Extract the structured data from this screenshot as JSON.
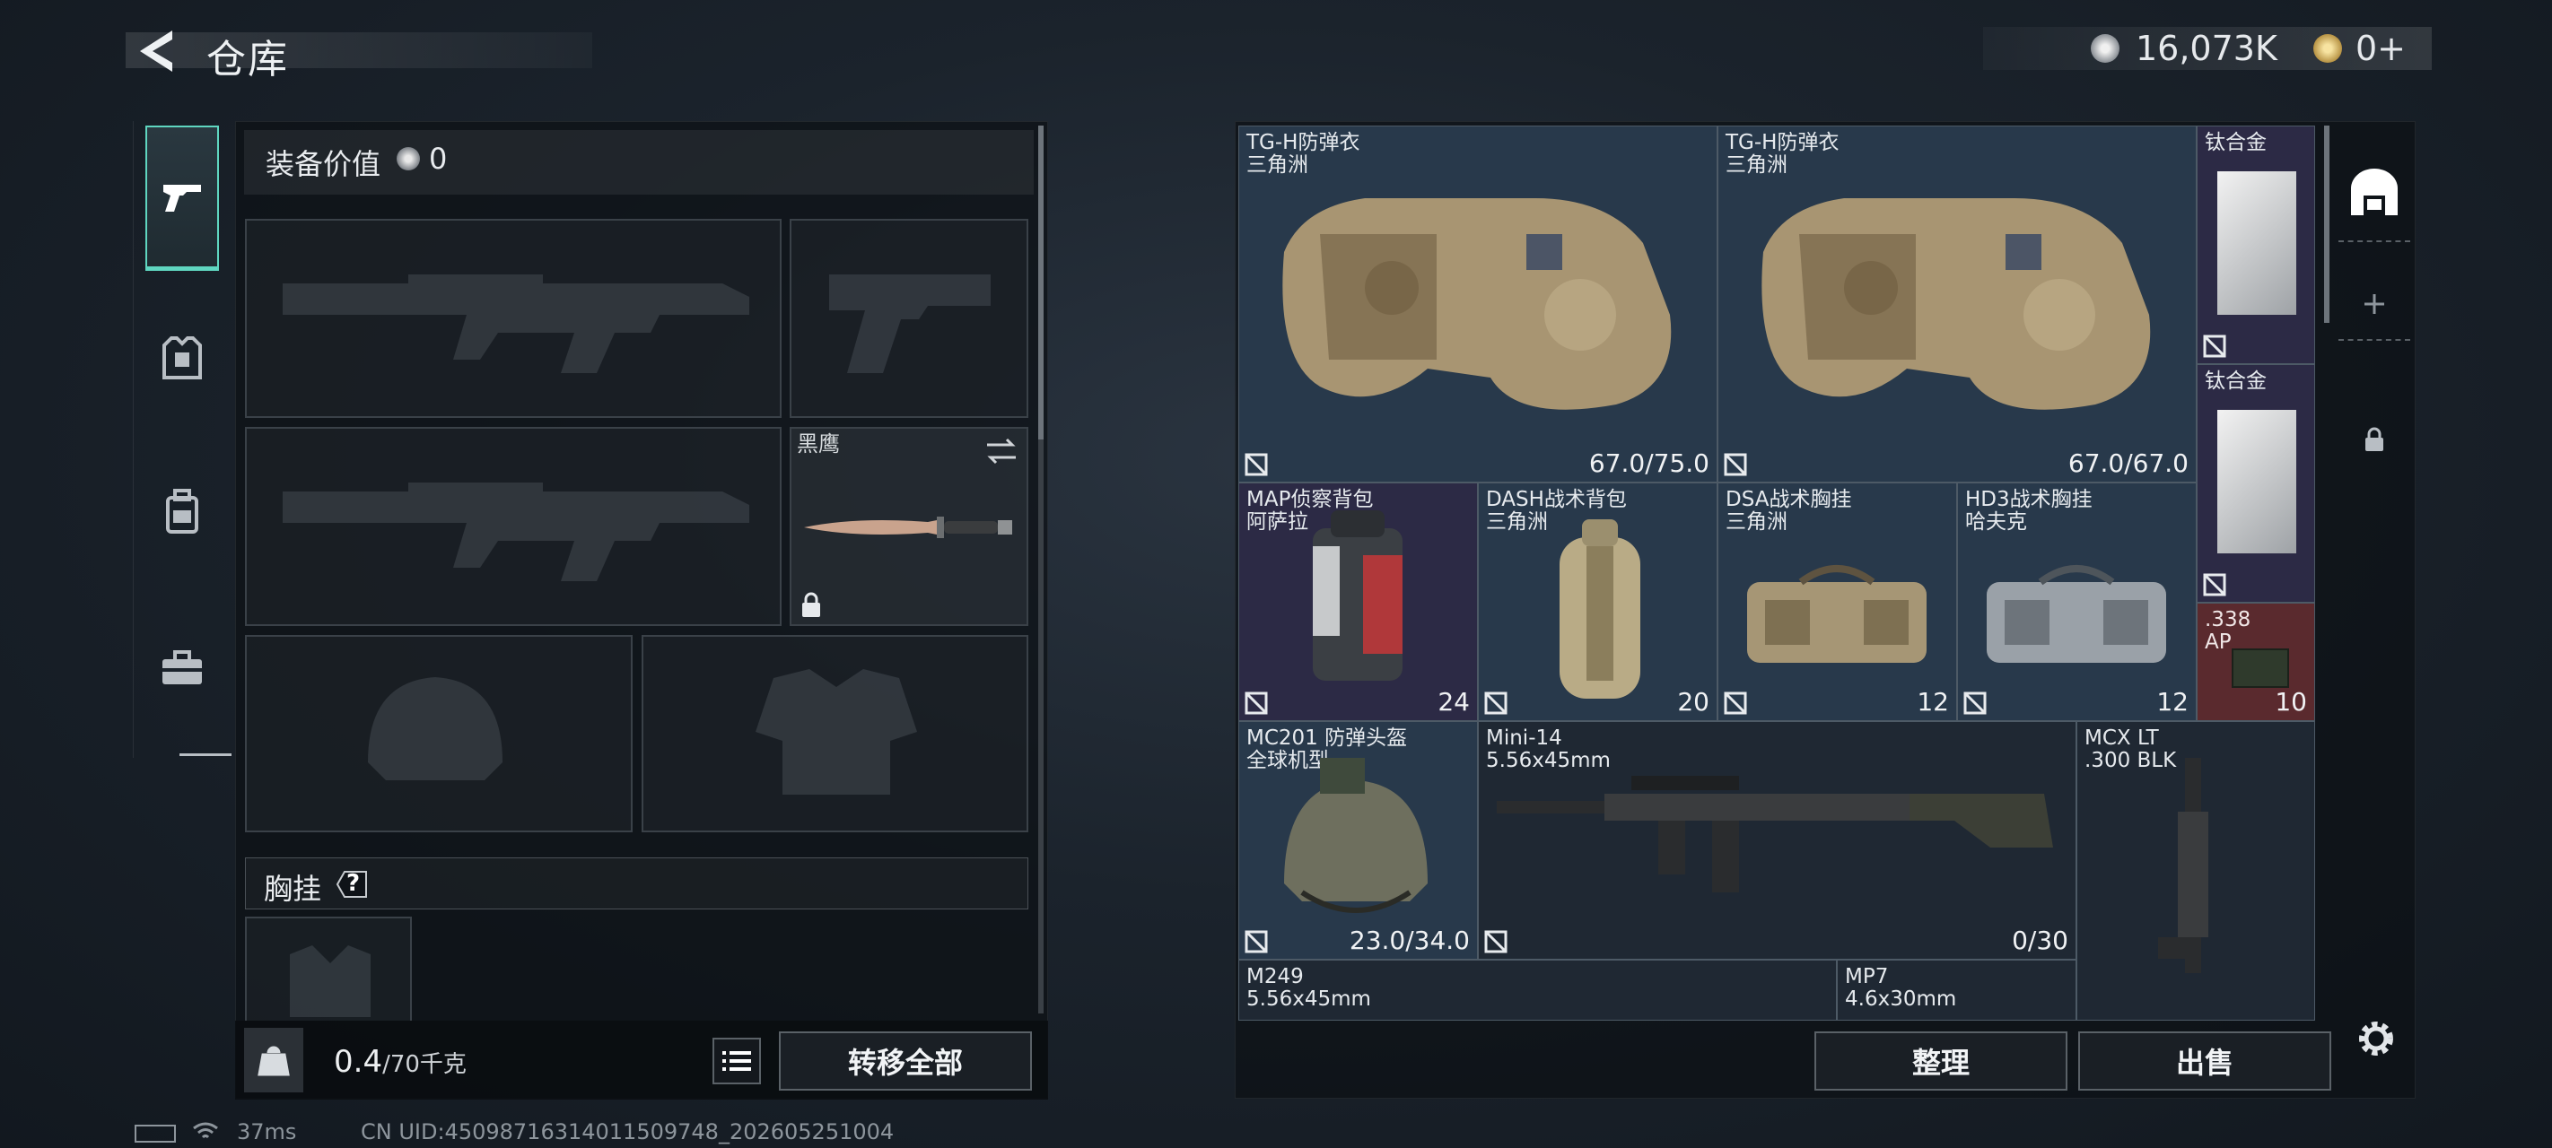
{
  "header": {
    "title": "仓库"
  },
  "currency": {
    "silver": "16,073K",
    "gold": "0+"
  },
  "left_nav": {
    "items": [
      {
        "name": "pistol"
      },
      {
        "name": "armor"
      },
      {
        "name": "backpack"
      },
      {
        "name": "case"
      }
    ]
  },
  "equipment": {
    "value_label": "装备价值",
    "value": "0",
    "melee_name": "黑鹰",
    "chest_rig_label": "胸挂",
    "chest_rig_help": "?",
    "weight_value": "0.4",
    "weight_max": "/70千克",
    "transfer_all": "转移全部"
  },
  "stash": {
    "items": [
      {
        "name": "TG-H防弹衣",
        "sub": "三角洲",
        "value": "67.0/75.0",
        "color": "#28394b"
      },
      {
        "name": "TG-H防弹衣",
        "sub": "三角洲",
        "value": "67.0/67.0",
        "color": "#28394b"
      },
      {
        "name": "钛合金",
        "sub": "",
        "value": "",
        "color": "#2c2a45"
      },
      {
        "name": "钛合金",
        "sub": "",
        "value": "",
        "color": "#2c2a45"
      },
      {
        "name": "MAP侦察背包",
        "sub": "阿萨拉",
        "value": "24",
        "color": "#2c2a45"
      },
      {
        "name": "DASH战术背包",
        "sub": "三角洲",
        "value": "20",
        "color": "#28394b"
      },
      {
        "name": "DSA战术胸挂",
        "sub": "三角洲",
        "value": "12",
        "color": "#28394b"
      },
      {
        "name": "HD3战术胸挂",
        "sub": "哈夫克",
        "value": "12",
        "color": "#28394b"
      },
      {
        "name": ".338",
        "sub": "AP",
        "value": "10",
        "color": "#5a2a2e"
      },
      {
        "name": "MC201 防弹头盔",
        "sub": "全球机型",
        "value": "23.0/34.0",
        "color": "#28394b"
      },
      {
        "name": "Mini-14",
        "sub": "5.56x45mm",
        "value": "0/30",
        "color": "#1f2833"
      },
      {
        "name": "MCX LT",
        "sub": ".300 BLK",
        "value": "",
        "color": "#1f2833"
      },
      {
        "name": "M249",
        "sub": "5.56x45mm",
        "value": "",
        "color": "#1f2833"
      },
      {
        "name": "MP7",
        "sub": "4.6x30mm",
        "value": "",
        "color": "#1f2833"
      }
    ],
    "sort_button": "整理",
    "sell_button": "出售"
  },
  "status_bar": {
    "ping": "37ms",
    "uid": "CN UID:4509871631401150974​8_202605251004"
  }
}
